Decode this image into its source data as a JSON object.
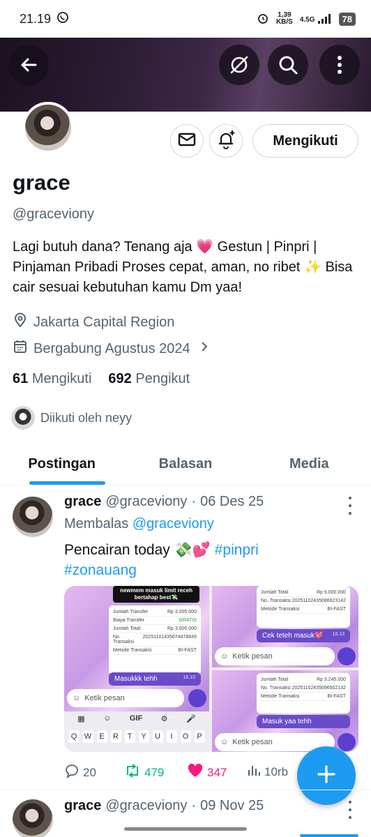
{
  "status_bar": {
    "time": "21.19",
    "net_speed": "1,39",
    "net_unit": "KB/S",
    "network": "4.5G",
    "battery": "78"
  },
  "header": {
    "back_icon": "arrow-left-icon",
    "grok_icon": "grok-icon",
    "search_icon": "search-icon",
    "more_icon": "more-vertical-icon"
  },
  "profile": {
    "name": "grace",
    "handle": "@graceviony",
    "bio": "Lagi butuh dana? Tenang aja 💗 Gestun | Pinpri | Pinjaman Pribadi Proses cepat, aman, no ribet ✨ Bisa cair sesuai kebutuhan kamu Dm yaa!",
    "location": "Jakarta Capital Region",
    "joined": "Bergabung Agustus 2024",
    "following_count": "61",
    "following_label": "Mengikuti",
    "followers_count": "692",
    "followers_label": "Pengikut",
    "followed_by": "Diikuti oleh neyy",
    "follow_button": "Mengikuti"
  },
  "tabs": [
    {
      "label": "Postingan",
      "active": true
    },
    {
      "label": "Balasan",
      "active": false
    },
    {
      "label": "Media",
      "active": false
    }
  ],
  "post1": {
    "name": "grace",
    "handle": "@graceviony",
    "dot": "·",
    "date": "06 Des 25",
    "reply_prefix": "Membalas",
    "reply_to": "@graceviony",
    "text_main": "Pencairan today 💸💕",
    "tag1": "#pinpri",
    "tag2": "#zonauang",
    "replies": "20",
    "reposts": "479",
    "likes": "347",
    "views": "10rb"
  },
  "media": {
    "tile1_label": "newmem masuk limit receh bertahap best💸",
    "tile1_bubble": "Masukkk tehh",
    "tile1_time": "16.15",
    "tile1_rows": [
      [
        "Jumlah Transfer",
        "Rp 3.005.000"
      ],
      [
        "Biaya Transfer",
        "GRATIS"
      ],
      [
        "Jumlah Total",
        "Rp 3.005.000"
      ],
      [
        "No. Transaksi",
        "20251101435074478649"
      ],
      [
        "Metode Transaksi",
        "BI-FAST"
      ]
    ],
    "tile2_rows": [
      [
        "Jumlah Total",
        "Rp 5.000.000"
      ],
      [
        "No. Transaksi",
        "20251102435086623142"
      ],
      [
        "Metode Transaksi",
        "BI-FAST"
      ]
    ],
    "tile2_bubble": "Cek teteh masuk💖",
    "tile2_time": "18.13",
    "tile3_rows": [
      [
        "Jumlah Total",
        "Rp 3.245.000"
      ],
      [
        "No. Transaksi",
        "20251102435096502132"
      ],
      [
        "Metode Transaksi",
        "BI-FAST"
      ]
    ],
    "tile3_bubble": "Masuk yaa tehh",
    "input_placeholder": "Ketik pesan",
    "kb_gif": "GIF",
    "kb_keys": [
      "Q",
      "W",
      "E",
      "R",
      "T",
      "Y",
      "U",
      "I",
      "O",
      "P"
    ]
  },
  "post2": {
    "name": "grace",
    "handle": "@graceviony",
    "dot": "·",
    "date": "09 Nov 25"
  },
  "colors": {
    "accent": "#1d9bf0",
    "repost": "#00ba7c",
    "like": "#f91880",
    "muted": "#536471"
  }
}
